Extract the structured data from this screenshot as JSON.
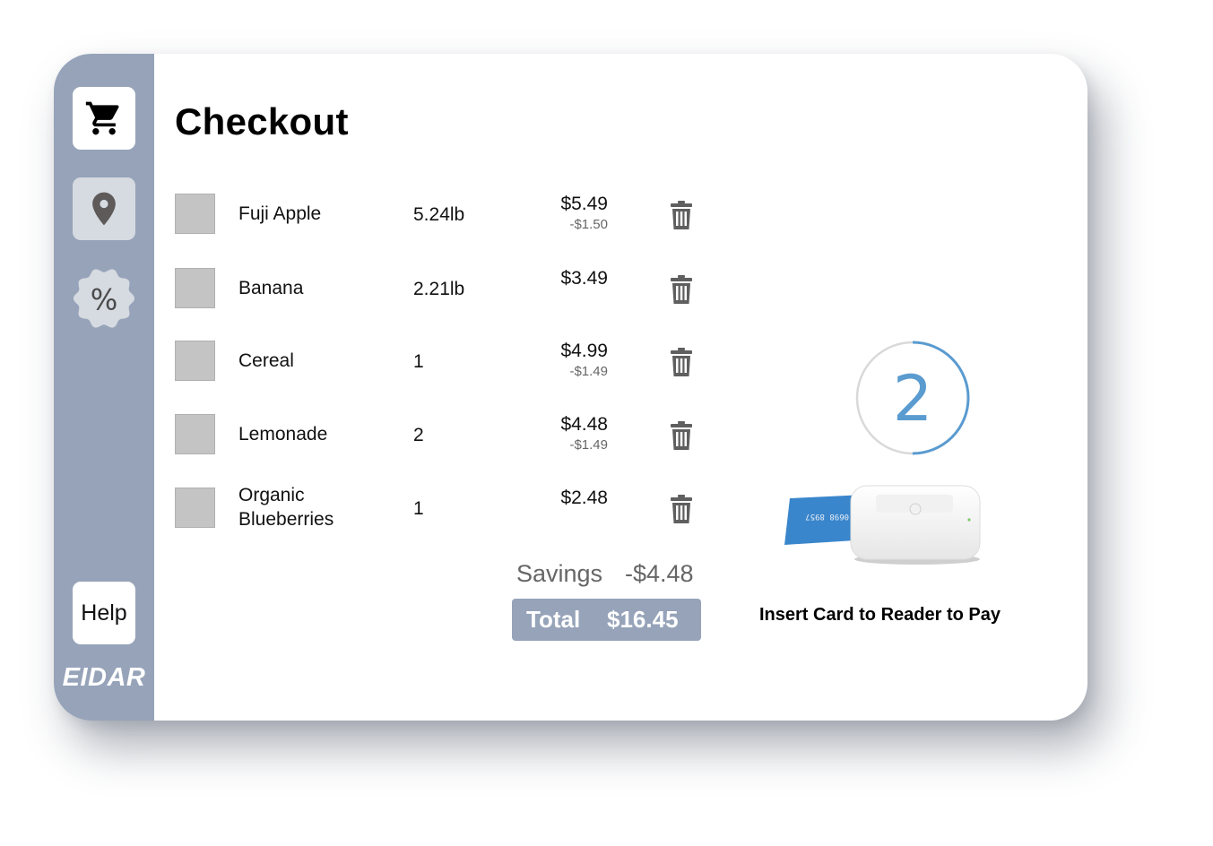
{
  "header": {
    "title": "Checkout"
  },
  "sidebar": {
    "items": [
      {
        "name": "cart",
        "icon": "cart-icon"
      },
      {
        "name": "location",
        "icon": "map-pin-icon"
      },
      {
        "name": "deals",
        "icon": "percent-badge-icon",
        "label": "%"
      }
    ],
    "help_label": "Help",
    "brand": "EIDAR"
  },
  "cart": {
    "items": [
      {
        "name": "Fuji Apple",
        "qty": "5.24lb",
        "price": "$5.49",
        "discount": "-$1.50"
      },
      {
        "name": "Banana",
        "qty": "2.21lb",
        "price": "$3.49",
        "discount": ""
      },
      {
        "name": "Cereal",
        "qty": "1",
        "price": "$4.99",
        "discount": "-$1.49"
      },
      {
        "name": "Lemonade",
        "qty": "2",
        "price": "$4.48",
        "discount": "-$1.49"
      },
      {
        "name": "Organic\nBlueberries",
        "qty": "1",
        "price": "$2.48",
        "discount": ""
      }
    ],
    "savings_label": "Savings",
    "savings_value": "-$4.48",
    "total_label": "Total",
    "total_value": "$16.45"
  },
  "payment": {
    "countdown": "2",
    "countdown_progress": 0.5,
    "instruction": "Insert Card to Reader to Pay",
    "card_number_fragment": "0698 8957"
  },
  "colors": {
    "sidebar": "#96a3b9",
    "accent": "#5a9bd0",
    "card_blue": "#3a86cc",
    "icon_gray": "#555555"
  }
}
